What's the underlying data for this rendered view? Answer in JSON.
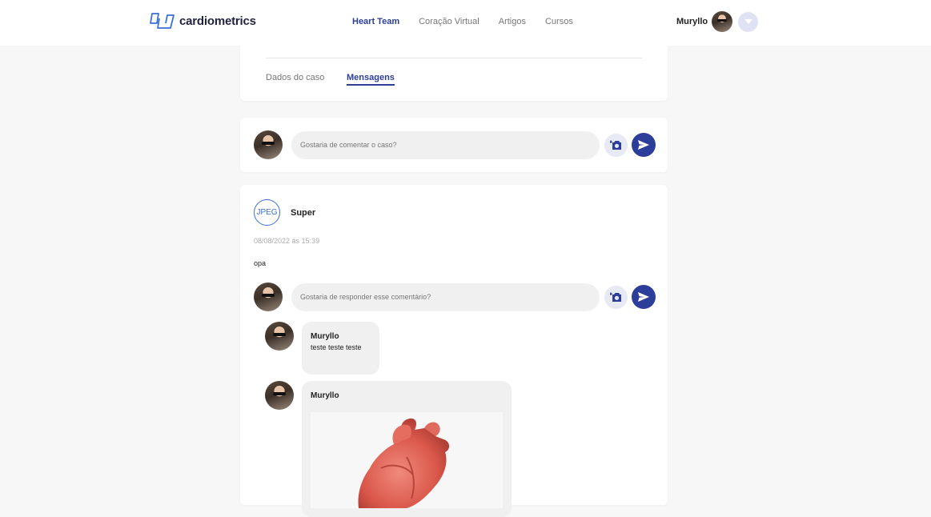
{
  "brand": {
    "name": "cardiometrics"
  },
  "nav": {
    "items": [
      {
        "label": "Heart Team",
        "active": true
      },
      {
        "label": "Coração Virtual",
        "active": false
      },
      {
        "label": "Artigos",
        "active": false
      },
      {
        "label": "Cursos",
        "active": false
      }
    ]
  },
  "user": {
    "name": "Muryllo"
  },
  "tabs": [
    {
      "label": "Dados do caso",
      "active": false
    },
    {
      "label": "Mensagens",
      "active": true
    }
  ],
  "composer": {
    "placeholder": "Gostaria de comentar o caso?"
  },
  "post": {
    "badge": "JPEG",
    "author": "Super",
    "date": "08/08/2022 ás 15:39",
    "body": "opa",
    "reply_placeholder": "Gostaria de responder esse comentário?",
    "replies": [
      {
        "author": "Muryllo",
        "text": "teste teste teste"
      },
      {
        "author": "Muryllo",
        "image": "heart-model"
      }
    ]
  },
  "colors": {
    "accent": "#2d3e9a",
    "badge": "#3b6fd8",
    "page_bg": "#f7f7f7"
  }
}
